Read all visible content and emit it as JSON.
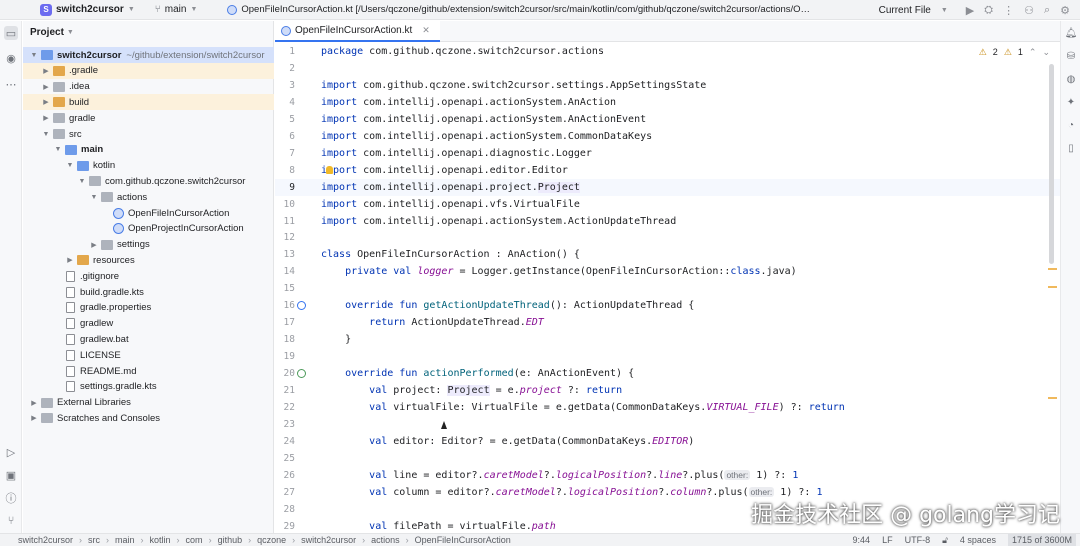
{
  "titlebar": {
    "project_name": "switch2cursor",
    "project_badge": "S",
    "branch": "main",
    "file_path": "OpenFileInCursorAction.kt [/Users/qczone/github/extension/switch2cursor/src/main/kotlin/com/github/qczone/switch2cursor/actions/OpenFileInCursorAction.kt]",
    "run_config": "Current File"
  },
  "project_panel": {
    "title": "Project",
    "tree": [
      {
        "label": "switch2cursor",
        "extra": "~/github/extension/switch2cursor",
        "depth": 0,
        "kind": "folder-blue",
        "expanded": true,
        "bold": true,
        "state": "sel"
      },
      {
        "label": ".gradle",
        "depth": 1,
        "kind": "folder-orange",
        "expanded": false,
        "state": "ex"
      },
      {
        "label": ".idea",
        "depth": 1,
        "kind": "folder",
        "expanded": false,
        "state": ""
      },
      {
        "label": "build",
        "depth": 1,
        "kind": "folder-orange",
        "expanded": false,
        "state": "ex"
      },
      {
        "label": "gradle",
        "depth": 1,
        "kind": "folder",
        "expanded": false,
        "state": ""
      },
      {
        "label": "src",
        "depth": 1,
        "kind": "folder",
        "expanded": true,
        "state": ""
      },
      {
        "label": "main",
        "depth": 2,
        "kind": "folder-blue",
        "expanded": true,
        "bold": true,
        "state": ""
      },
      {
        "label": "kotlin",
        "depth": 3,
        "kind": "folder-blue",
        "expanded": true,
        "state": ""
      },
      {
        "label": "com.github.qczone.switch2cursor",
        "depth": 4,
        "kind": "folder",
        "expanded": true,
        "state": ""
      },
      {
        "label": "actions",
        "depth": 5,
        "kind": "folder",
        "expanded": true,
        "state": ""
      },
      {
        "label": "OpenFileInCursorAction",
        "depth": 6,
        "kind": "class",
        "leaf": true,
        "state": ""
      },
      {
        "label": "OpenProjectInCursorAction",
        "depth": 6,
        "kind": "class",
        "leaf": true,
        "state": ""
      },
      {
        "label": "settings",
        "depth": 5,
        "kind": "folder",
        "expanded": false,
        "state": ""
      },
      {
        "label": "resources",
        "depth": 3,
        "kind": "folder-orange",
        "expanded": false,
        "state": ""
      },
      {
        "label": ".gitignore",
        "depth": 2,
        "kind": "file",
        "leaf": true,
        "state": ""
      },
      {
        "label": "build.gradle.kts",
        "depth": 2,
        "kind": "file",
        "leaf": true,
        "state": ""
      },
      {
        "label": "gradle.properties",
        "depth": 2,
        "kind": "file",
        "leaf": true,
        "state": ""
      },
      {
        "label": "gradlew",
        "depth": 2,
        "kind": "file",
        "leaf": true,
        "state": ""
      },
      {
        "label": "gradlew.bat",
        "depth": 2,
        "kind": "file",
        "leaf": true,
        "state": ""
      },
      {
        "label": "LICENSE",
        "depth": 2,
        "kind": "file",
        "leaf": true,
        "state": ""
      },
      {
        "label": "README.md",
        "depth": 2,
        "kind": "file",
        "leaf": true,
        "state": ""
      },
      {
        "label": "settings.gradle.kts",
        "depth": 2,
        "kind": "file",
        "leaf": true,
        "state": ""
      },
      {
        "label": "External Libraries",
        "depth": 0,
        "kind": "folder",
        "expanded": false,
        "state": ""
      },
      {
        "label": "Scratches and Consoles",
        "depth": 0,
        "kind": "folder",
        "expanded": false,
        "state": ""
      }
    ]
  },
  "editor": {
    "tab_label": "OpenFileInCursorAction.kt",
    "warnings": "2",
    "weak_warnings": "1",
    "current_line": 9,
    "lines": [
      {
        "n": "1",
        "segs": [
          [
            "kw",
            "package "
          ],
          [
            "",
            "com.github.qczone.switch2cursor.actions"
          ]
        ]
      },
      {
        "n": "2",
        "segs": []
      },
      {
        "n": "3",
        "segs": [
          [
            "kw",
            "import "
          ],
          [
            "",
            "com.github.qczone.switch2cursor.settings.AppSettingsState"
          ]
        ]
      },
      {
        "n": "4",
        "segs": [
          [
            "kw",
            "import "
          ],
          [
            "",
            "com.intellij.openapi.actionSystem.AnAction"
          ]
        ]
      },
      {
        "n": "5",
        "segs": [
          [
            "kw",
            "import "
          ],
          [
            "",
            "com.intellij.openapi.actionSystem.AnActionEvent"
          ]
        ]
      },
      {
        "n": "6",
        "segs": [
          [
            "kw",
            "import "
          ],
          [
            "",
            "com.intellij.openapi.actionSystem.CommonDataKeys"
          ]
        ]
      },
      {
        "n": "7",
        "segs": [
          [
            "kw",
            "import "
          ],
          [
            "",
            "com.intellij.openapi.diagnostic.Logger"
          ]
        ]
      },
      {
        "n": "8",
        "segs": [
          [
            "kw",
            "import "
          ],
          [
            "",
            "com.intellij.openapi.editor.Editor"
          ]
        ]
      },
      {
        "n": "9",
        "segs": [
          [
            "kw",
            "import "
          ],
          [
            "",
            "com.intellij.openapi.project."
          ],
          [
            "refhl",
            "Project"
          ]
        ]
      },
      {
        "n": "10",
        "segs": [
          [
            "kw",
            "import "
          ],
          [
            "",
            "com.intellij.openapi.vfs.VirtualFile"
          ]
        ]
      },
      {
        "n": "11",
        "segs": [
          [
            "kw",
            "import "
          ],
          [
            "",
            "com.intellij.openapi.actionSystem.ActionUpdateThread"
          ]
        ]
      },
      {
        "n": "12",
        "segs": []
      },
      {
        "n": "13",
        "segs": [
          [
            "kw",
            "class "
          ],
          [
            "",
            "OpenFileInCursorAction : AnAction() {"
          ]
        ]
      },
      {
        "n": "14",
        "segs": [
          [
            "",
            "    "
          ],
          [
            "kw",
            "private val "
          ],
          [
            "it",
            "logger"
          ],
          [
            "",
            " = Logger.getInstance(OpenFileInCursorAction::"
          ],
          [
            "kw",
            "class"
          ],
          [
            "",
            ".java)"
          ]
        ]
      },
      {
        "n": "15",
        "segs": []
      },
      {
        "n": "16",
        "segs": [
          [
            "",
            "    "
          ],
          [
            "kw",
            "override fun "
          ],
          [
            "fn",
            "getActionUpdateThread"
          ],
          [
            "",
            "(): ActionUpdateThread {"
          ]
        ]
      },
      {
        "n": "17",
        "segs": [
          [
            "",
            "        "
          ],
          [
            "kw",
            "return "
          ],
          [
            "",
            "ActionUpdateThread."
          ],
          [
            "it",
            "EDT"
          ]
        ]
      },
      {
        "n": "18",
        "segs": [
          [
            "",
            "    }"
          ]
        ]
      },
      {
        "n": "19",
        "segs": []
      },
      {
        "n": "20",
        "segs": [
          [
            "",
            "    "
          ],
          [
            "kw",
            "override fun "
          ],
          [
            "fn",
            "actionPerformed"
          ],
          [
            "",
            "(e: AnActionEvent) {"
          ]
        ]
      },
      {
        "n": "21",
        "segs": [
          [
            "",
            "        "
          ],
          [
            "kw",
            "val "
          ],
          [
            "",
            "project: "
          ],
          [
            "refhl",
            "Project"
          ],
          [
            "",
            " = e."
          ],
          [
            "it",
            "project"
          ],
          [
            "",
            " ?: "
          ],
          [
            "kw",
            "return"
          ]
        ]
      },
      {
        "n": "22",
        "segs": [
          [
            "",
            "        "
          ],
          [
            "kw",
            "val "
          ],
          [
            "",
            "virtualFile: VirtualFile = e.getData(CommonDataKeys."
          ],
          [
            "it",
            "VIRTUAL_FILE"
          ],
          [
            "",
            ") ?: "
          ],
          [
            "kw",
            "return"
          ]
        ]
      },
      {
        "n": "23",
        "segs": []
      },
      {
        "n": "24",
        "segs": [
          [
            "",
            "        "
          ],
          [
            "kw",
            "val "
          ],
          [
            "",
            "editor: Editor? = e.getData(CommonDataKeys."
          ],
          [
            "it",
            "EDITOR"
          ],
          [
            "",
            ")"
          ]
        ]
      },
      {
        "n": "25",
        "segs": []
      },
      {
        "n": "26",
        "segs": [
          [
            "",
            "        "
          ],
          [
            "kw",
            "val "
          ],
          [
            "",
            "line = editor?."
          ],
          [
            "it",
            "caretModel"
          ],
          [
            "",
            "?."
          ],
          [
            "it",
            "logicalPosition"
          ],
          [
            "",
            "?."
          ],
          [
            "it",
            "line"
          ],
          [
            "",
            "?.plus("
          ],
          [
            "hint",
            "other:"
          ],
          [
            "",
            " 1) ?: "
          ],
          [
            "kw",
            "1"
          ]
        ]
      },
      {
        "n": "27",
        "segs": [
          [
            "",
            "        "
          ],
          [
            "kw",
            "val "
          ],
          [
            "",
            "column = editor?."
          ],
          [
            "it",
            "caretModel"
          ],
          [
            "",
            "?."
          ],
          [
            "it",
            "logicalPosition"
          ],
          [
            "",
            "?."
          ],
          [
            "it",
            "column"
          ],
          [
            "",
            "?.plus("
          ],
          [
            "hint",
            "other:"
          ],
          [
            "",
            " 1) ?: "
          ],
          [
            "kw",
            "1"
          ]
        ]
      },
      {
        "n": "28",
        "segs": []
      },
      {
        "n": "29",
        "segs": [
          [
            "",
            "        "
          ],
          [
            "kw",
            "val "
          ],
          [
            "",
            "filePath = virtualFile."
          ],
          [
            "it",
            "path"
          ]
        ]
      }
    ]
  },
  "statusbar": {
    "breadcrumbs": [
      "switch2cursor",
      "src",
      "main",
      "kotlin",
      "com",
      "github",
      "qczone",
      "switch2cursor",
      "actions",
      "OpenFileInCursorAction"
    ],
    "position": "9:44",
    "line_sep": "LF",
    "encoding": "UTF-8",
    "indent": "4 spaces",
    "memory": "1715 of 3600M"
  },
  "watermark": "掘金技术社区 @ golang学习记"
}
